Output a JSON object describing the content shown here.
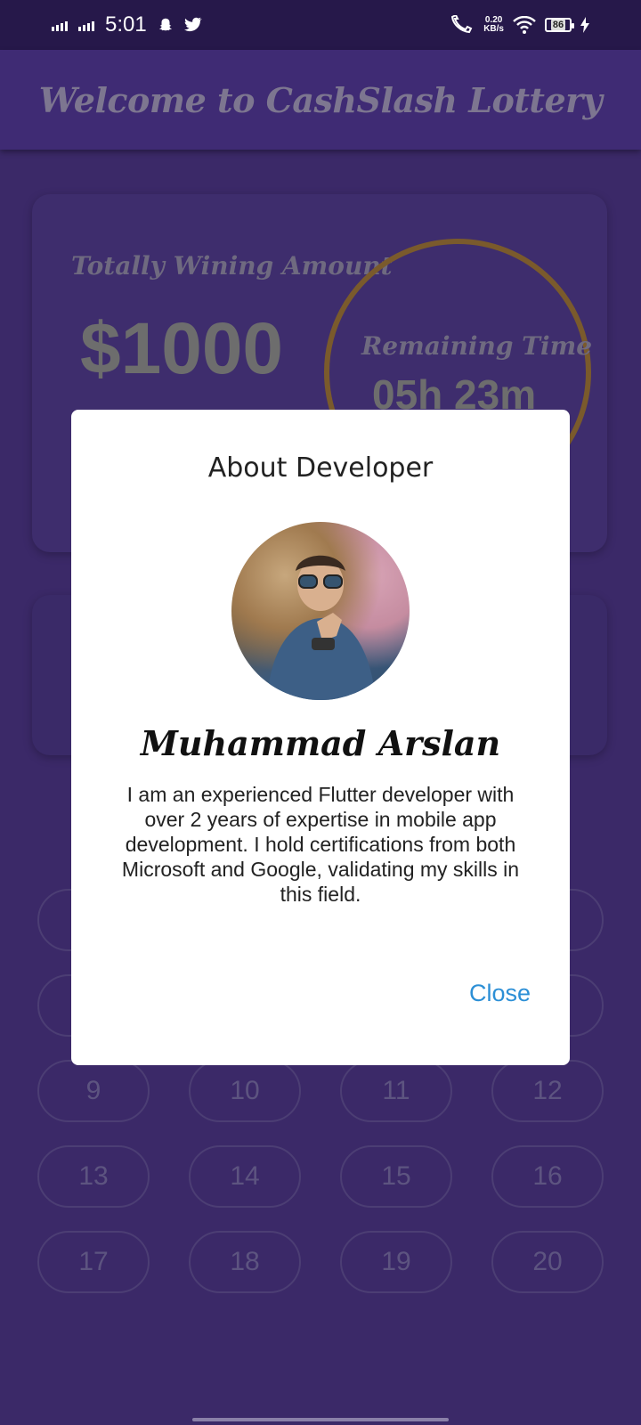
{
  "status_bar": {
    "time": "5:01",
    "net_speed_value": "0.20",
    "net_speed_unit": "KB/s",
    "battery": "86"
  },
  "app_bar": {
    "title": "Welcome to CashSlash Lottery"
  },
  "summary_card": {
    "amount_label": "Totally Wining Amount",
    "amount_value": "$1000",
    "timer_label": "Remaining Time",
    "timer_value": "05h 23m"
  },
  "numbers": [
    "9",
    "10",
    "11",
    "12",
    "13",
    "14",
    "15",
    "16",
    "17",
    "18",
    "19",
    "20"
  ],
  "dialog": {
    "title": "About Developer",
    "name": "Muhammad Arslan",
    "bio": "I am an experienced Flutter developer with over 2 years of expertise in mobile app development. I hold certifications from both Microsoft and Google, validating my skills in this field.",
    "close_label": "Close"
  },
  "colors": {
    "background": "#3b2968",
    "app_bar": "#3f2b74",
    "accent_link": "#2c8fd6",
    "timer_ring": "#7a5a2c"
  }
}
